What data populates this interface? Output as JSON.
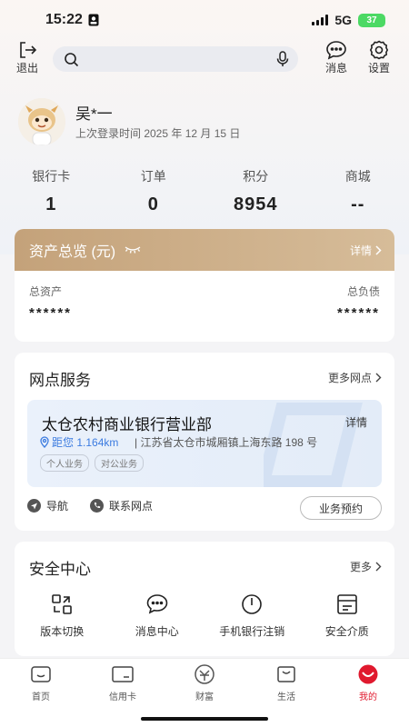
{
  "status_bar": {
    "time": "15:22",
    "network": "5G",
    "battery": "37"
  },
  "header": {
    "logout_label": "退出",
    "search_placeholder": "",
    "messages_label": "消息",
    "settings_label": "设置"
  },
  "profile": {
    "name": "吴*一",
    "last_login": "上次登录时间 2025 年 12 月 15 日"
  },
  "stats": [
    {
      "label": "银行卡",
      "value": "1"
    },
    {
      "label": "订单",
      "value": "0"
    },
    {
      "label": "积分",
      "value": "8954"
    },
    {
      "label": "商城",
      "value": "--"
    }
  ],
  "assets": {
    "title": "资产总览 (元)",
    "more": "详情",
    "total_assets_label": "总资产",
    "total_assets_value": "******",
    "total_liabilities_label": "总负债",
    "total_liabilities_value": "******"
  },
  "branch": {
    "title": "网点服务",
    "more": "更多网点",
    "name": "太仓农村商业银行营业部",
    "detail": "详情",
    "distance": "距您 1.164km",
    "address": "| 江苏省太仓市城厢镇上海东路 198 号",
    "tags": [
      "个人业务",
      "对公业务"
    ],
    "navigate": "导航",
    "contact": "联系网点",
    "appointment": "业务预约"
  },
  "security": {
    "title": "安全中心",
    "more": "更多",
    "items": [
      {
        "label": "版本切换",
        "icon": "version-switch-icon"
      },
      {
        "label": "消息中心",
        "icon": "message-center-icon"
      },
      {
        "label": "手机银行注销",
        "icon": "power-icon"
      },
      {
        "label": "安全介质",
        "icon": "security-device-icon"
      }
    ]
  },
  "tabbar": [
    {
      "label": "首页",
      "icon": "home-icon"
    },
    {
      "label": "信用卡",
      "icon": "credit-card-icon"
    },
    {
      "label": "财富",
      "icon": "wealth-icon"
    },
    {
      "label": "生活",
      "icon": "life-icon"
    },
    {
      "label": "我的",
      "icon": "mine-icon",
      "active": true
    }
  ],
  "colors": {
    "accent": "#e0192e",
    "gold": "#c4a27a",
    "link_blue": "#3b7be0"
  }
}
